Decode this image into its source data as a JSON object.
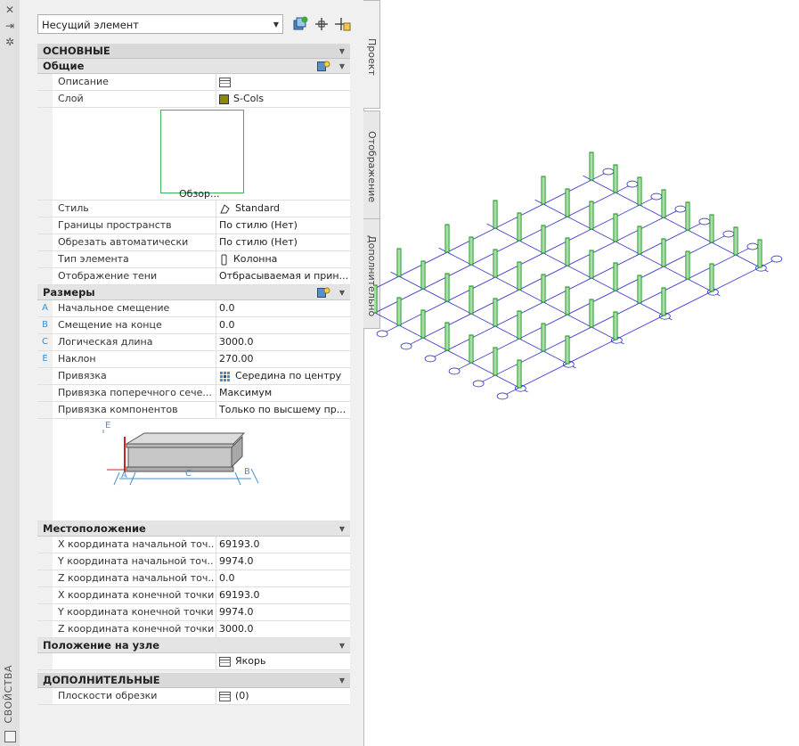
{
  "window": {
    "title": "СВОЙСТВА"
  },
  "toolbar": {
    "element_type": "Несущий элемент"
  },
  "tabs": [
    "Проект",
    "Отображение",
    "Дополнительно"
  ],
  "sections": {
    "basic": "ОСНОВНЫЕ",
    "general": "Общие",
    "dimensions": "Размеры",
    "location": "Местоположение",
    "anchor": "Положение на узле",
    "extra": "ДОПОЛНИТЕЛЬНЫЕ"
  },
  "general": {
    "description_label": "Описание",
    "layer_label": "Слой",
    "layer_value": "S-Cols",
    "layer_color": "#8a8a00",
    "preview_label": "Обзор...",
    "rows": [
      {
        "name": "Стиль",
        "value": "Standard"
      },
      {
        "name": "Границы пространств",
        "value": "По стилю (Нет)"
      },
      {
        "name": "Обрезать автоматически",
        "value": "По стилю (Нет)"
      },
      {
        "name": "Тип элемента",
        "value": "Колонна"
      },
      {
        "name": "Отображение тени",
        "value": "Отбрасываемая и прин..."
      }
    ]
  },
  "dimensions": {
    "rows": [
      {
        "key": "A",
        "name": "Начальное смещение",
        "value": "0.0"
      },
      {
        "key": "B",
        "name": "Смещение на конце",
        "value": "0.0"
      },
      {
        "key": "C",
        "name": "Логическая длина",
        "value": "3000.0"
      },
      {
        "key": "E",
        "name": "Наклон",
        "value": "270.00"
      },
      {
        "key": "",
        "name": "Привязка",
        "value": "Середина по центру"
      },
      {
        "key": "",
        "name": "Привязка поперечного сече...",
        "value": "Максимум"
      },
      {
        "key": "",
        "name": "Привязка компонентов",
        "value": "Только по высшему пр..."
      }
    ],
    "diagram_labels": {
      "a": "A",
      "b": "B",
      "c": "C",
      "e": "E"
    }
  },
  "location": {
    "rows": [
      {
        "name": "X координата начальной точ...",
        "value": "69193.0"
      },
      {
        "name": "Y координата начальной точ...",
        "value": "9974.0"
      },
      {
        "name": "Z координата начальной точ...",
        "value": "0.0"
      },
      {
        "name": "X координата конечной точки",
        "value": "69193.0"
      },
      {
        "name": "Y координата конечной точки",
        "value": "9974.0"
      },
      {
        "name": "Z координата конечной точки",
        "value": "3000.0"
      }
    ]
  },
  "anchor": {
    "value": "Якорь"
  },
  "extra": {
    "clip_label": "Плоскости обрезки",
    "clip_value": "(0)"
  },
  "colors": {
    "grid_line": "#3333cc",
    "column": "#1a9a1a",
    "accent": "#3a8fd0"
  }
}
